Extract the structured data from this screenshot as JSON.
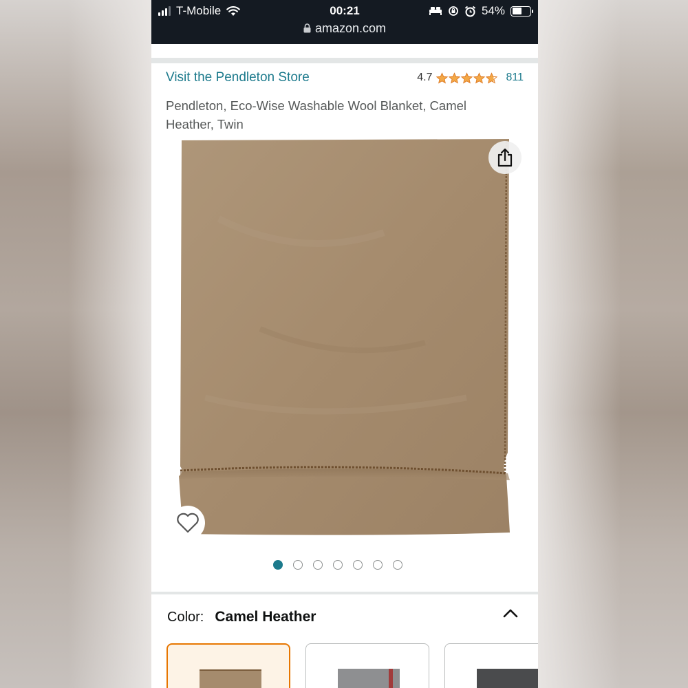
{
  "status_bar": {
    "carrier": "T-Mobile",
    "time": "00:21",
    "battery": "54%",
    "battery_level": 0.54,
    "url": "amazon.com"
  },
  "store": {
    "link": "Visit the Pendleton Store",
    "rating": "4.7",
    "stars_filled": 4.7,
    "rating_count": "811"
  },
  "product": {
    "title": "Pendleton, Eco-Wise Washable Wool Blanket, Camel Heather, Twin",
    "image_icon": "camel-blanket-photo",
    "carousel_total": 7,
    "carousel_active": 1
  },
  "color_section": {
    "label": "Color:",
    "value": "Camel Heather",
    "swatches": [
      {
        "name": "camel-heather",
        "selected": true
      },
      {
        "name": "grey",
        "selected": false
      },
      {
        "name": "charcoal",
        "selected": false
      }
    ]
  },
  "colors": {
    "link": "#1c7a8c",
    "star": "#f3a847",
    "selected_border": "#e77600",
    "blanket": "#a58b6e"
  }
}
